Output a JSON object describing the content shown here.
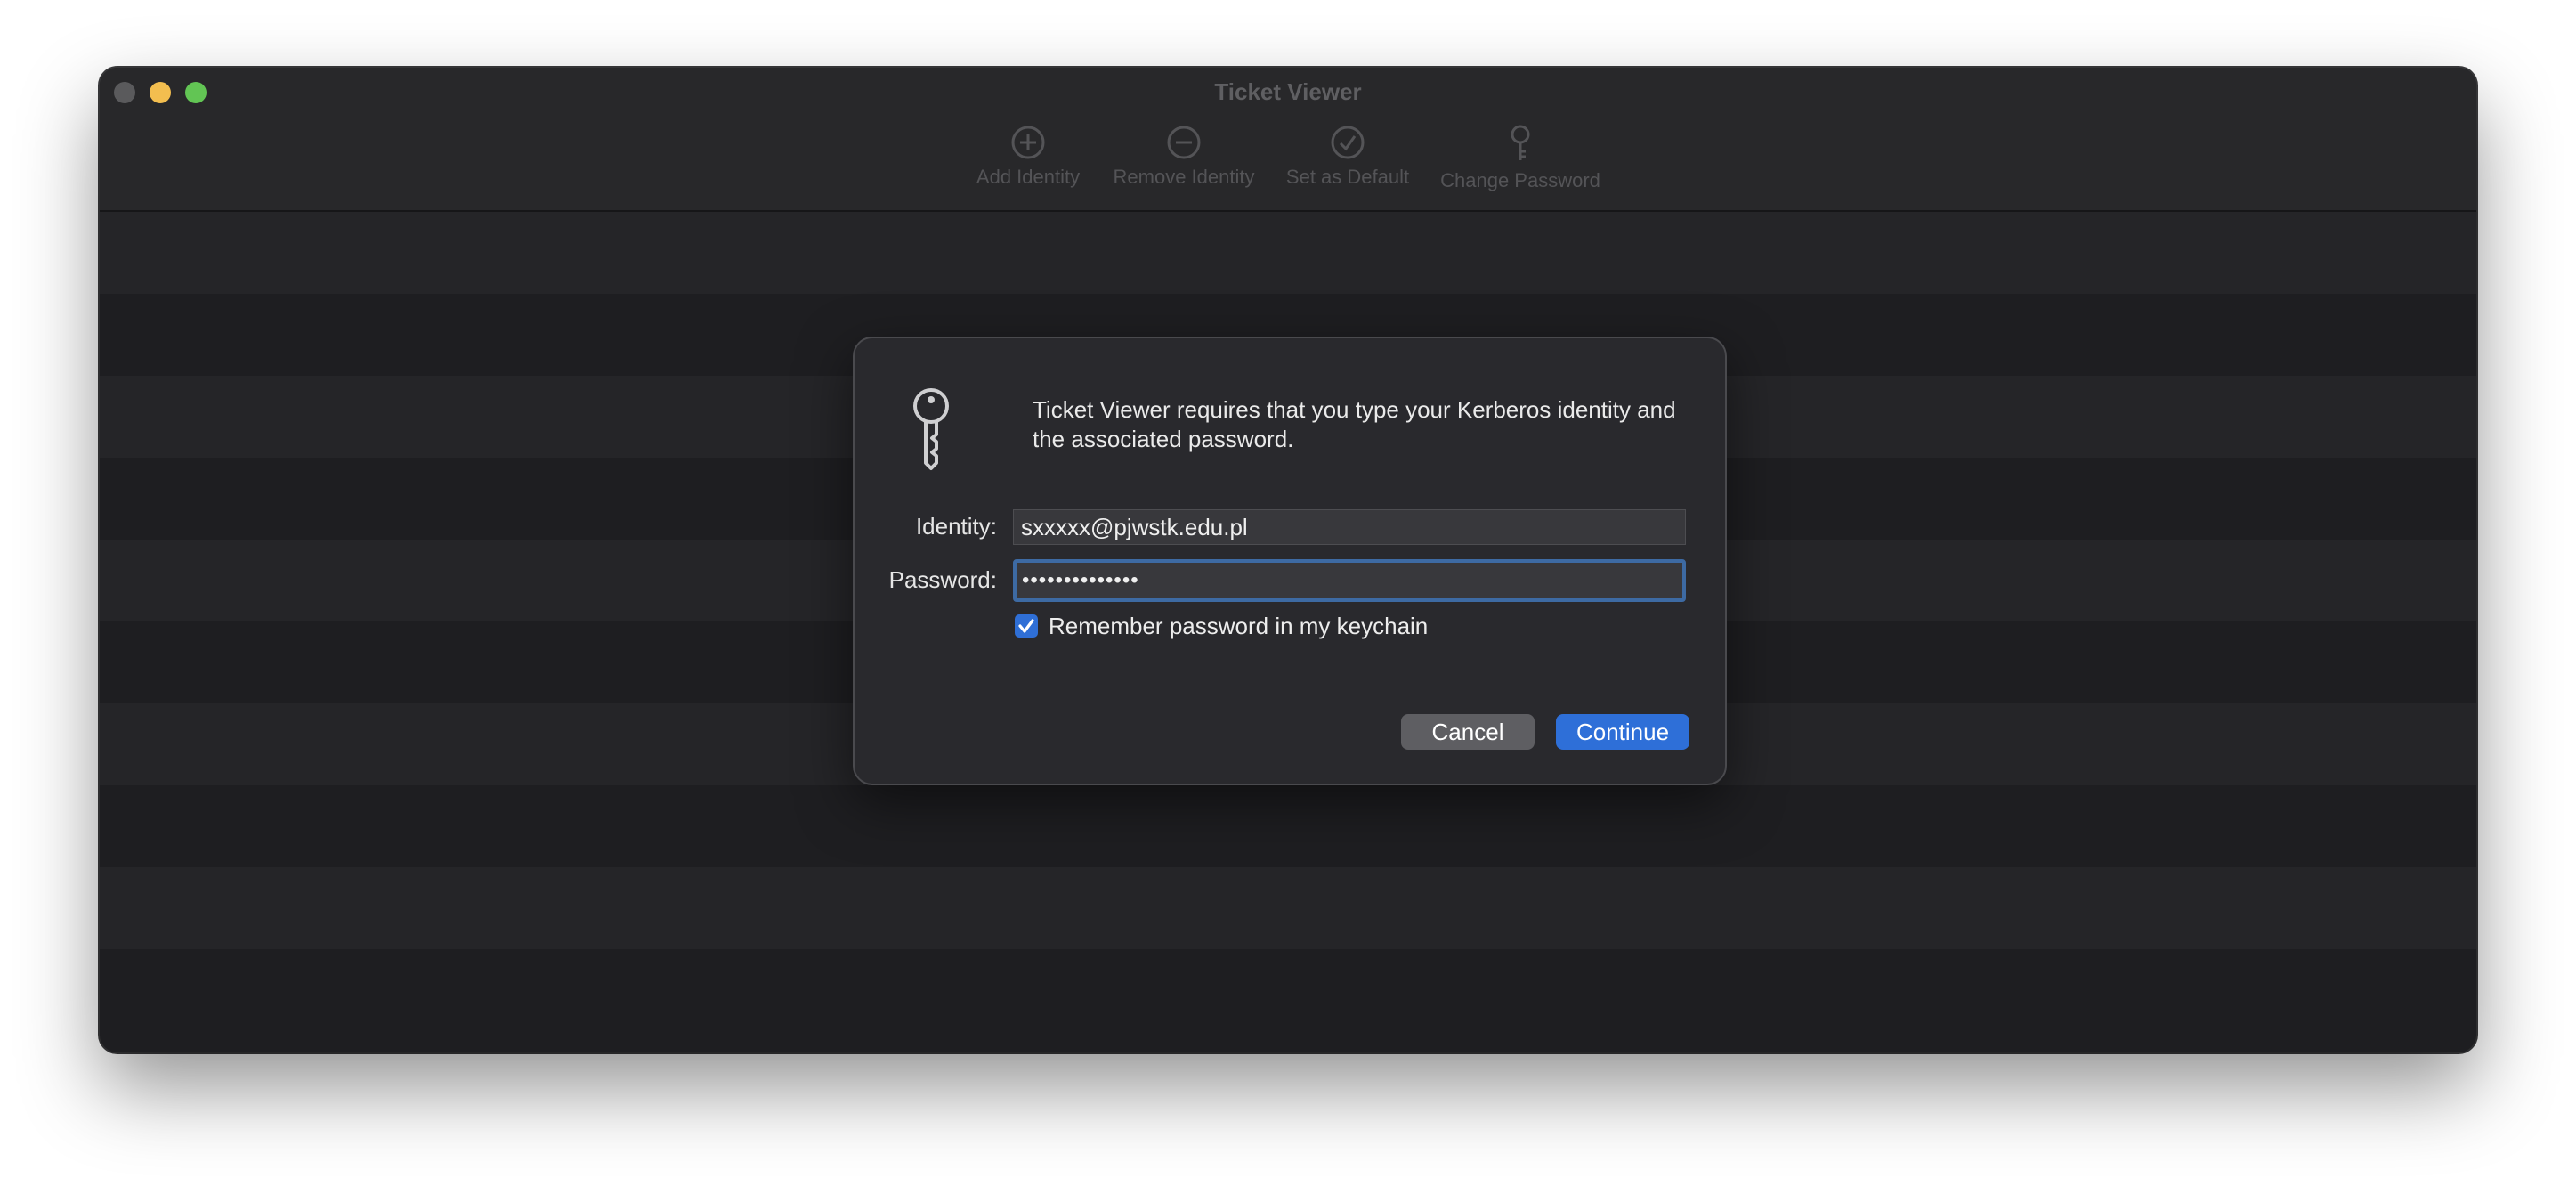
{
  "window": {
    "title": "Ticket Viewer"
  },
  "toolbar": {
    "items": [
      {
        "label": "Add Identity",
        "icon": "plus-circle-icon"
      },
      {
        "label": "Remove Identity",
        "icon": "minus-circle-icon"
      },
      {
        "label": "Set as Default",
        "icon": "checkmark-circle-icon"
      },
      {
        "label": "Change Password",
        "icon": "key-icon"
      }
    ]
  },
  "dialog": {
    "icon": "key-icon",
    "message": "Ticket Viewer requires that you type your Kerberos identity and the associated password.",
    "identity_label": "Identity:",
    "identity_value": "sxxxxx@pjwstk.edu.pl",
    "password_label": "Password:",
    "password_value": "••••••••••••••",
    "remember_label": "Remember password in my keychain",
    "remember_checked": true,
    "cancel_label": "Cancel",
    "continue_label": "Continue"
  },
  "colors": {
    "accent": "#2e6fd8",
    "window_bg": "#1e1e21",
    "dialog_bg": "#29292d"
  }
}
